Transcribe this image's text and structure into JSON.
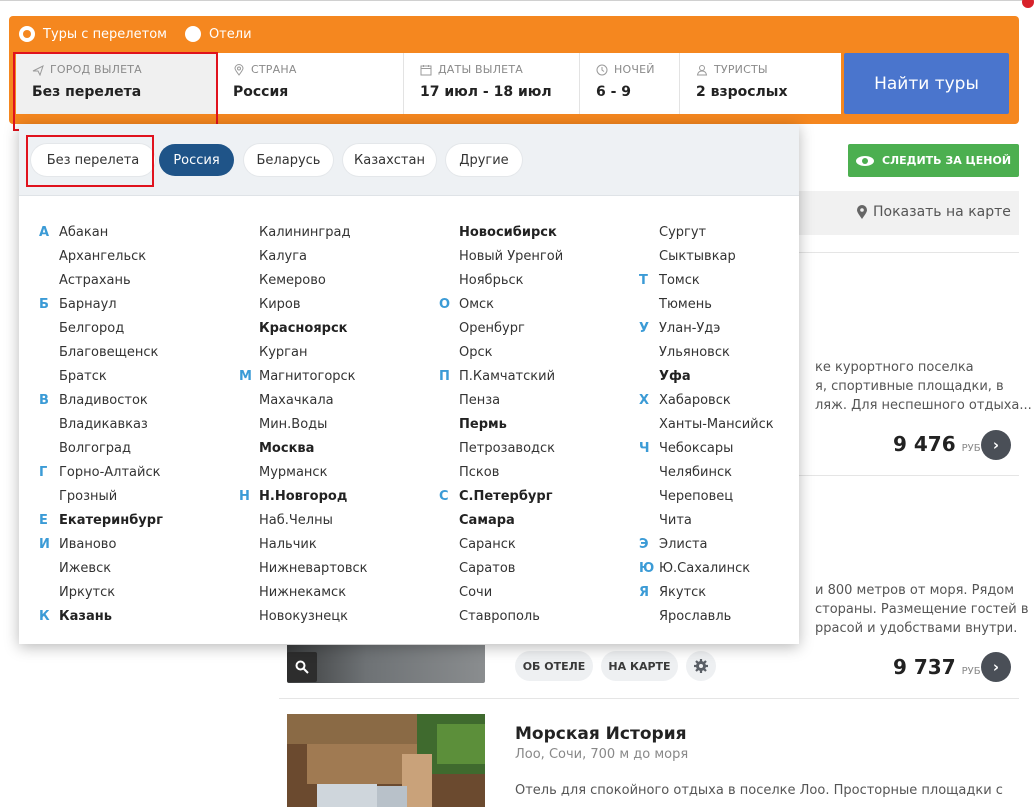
{
  "tour_type": {
    "options": [
      "Туры с перелетом",
      "Отели"
    ],
    "selected": "Туры с перелетом"
  },
  "fields": {
    "city": {
      "label": "ГОРОД ВЫЛЕТА",
      "value": "Без перелета",
      "icon": "plane-icon"
    },
    "country": {
      "label": "СТРАНА",
      "value": "Россия",
      "icon": "location-pin-icon"
    },
    "dates": {
      "label": "ДАТЫ ВЫЛЕТА",
      "value": "17 июл - 18 июл",
      "icon": "calendar-icon"
    },
    "nights": {
      "label": "НОЧЕЙ",
      "value": "6 - 9",
      "icon": "clock-icon"
    },
    "tourists": {
      "label": "ТУРИСТЫ",
      "value": "2 взрослых",
      "icon": "user-icon"
    }
  },
  "find_button": "Найти туры",
  "watch_price_button": "СЛЕДИТЬ ЗА ЦЕНОЙ",
  "show_on_map": "Показать на карте",
  "dropdown": {
    "tabs": [
      "Без перелета",
      "Россия",
      "Беларусь",
      "Казахстан",
      "Другие"
    ],
    "active_tab": "Россия",
    "columns": [
      [
        {
          "letter": "А",
          "name": "Абакан",
          "bold": false
        },
        {
          "letter": "",
          "name": "Архангельск",
          "bold": false
        },
        {
          "letter": "",
          "name": "Астрахань",
          "bold": false
        },
        {
          "letter": "Б",
          "name": "Барнаул",
          "bold": false
        },
        {
          "letter": "",
          "name": "Белгород",
          "bold": false
        },
        {
          "letter": "",
          "name": "Благовещенск",
          "bold": false
        },
        {
          "letter": "",
          "name": "Братск",
          "bold": false
        },
        {
          "letter": "В",
          "name": "Владивосток",
          "bold": false
        },
        {
          "letter": "",
          "name": "Владикавказ",
          "bold": false
        },
        {
          "letter": "",
          "name": "Волгоград",
          "bold": false
        },
        {
          "letter": "Г",
          "name": "Горно-Алтайск",
          "bold": false
        },
        {
          "letter": "",
          "name": "Грозный",
          "bold": false
        },
        {
          "letter": "Е",
          "name": "Екатеринбург",
          "bold": true
        },
        {
          "letter": "И",
          "name": "Иваново",
          "bold": false
        },
        {
          "letter": "",
          "name": "Ижевск",
          "bold": false
        },
        {
          "letter": "",
          "name": "Иркутск",
          "bold": false
        },
        {
          "letter": "К",
          "name": "Казань",
          "bold": true
        }
      ],
      [
        {
          "letter": "",
          "name": "Калининград",
          "bold": false
        },
        {
          "letter": "",
          "name": "Калуга",
          "bold": false
        },
        {
          "letter": "",
          "name": "Кемерово",
          "bold": false
        },
        {
          "letter": "",
          "name": "Киров",
          "bold": false
        },
        {
          "letter": "",
          "name": "Красноярск",
          "bold": true
        },
        {
          "letter": "",
          "name": "Курган",
          "bold": false
        },
        {
          "letter": "М",
          "name": "Магнитогорск",
          "bold": false
        },
        {
          "letter": "",
          "name": "Махачкала",
          "bold": false
        },
        {
          "letter": "",
          "name": "Мин.Воды",
          "bold": false
        },
        {
          "letter": "",
          "name": "Москва",
          "bold": true
        },
        {
          "letter": "",
          "name": "Мурманск",
          "bold": false
        },
        {
          "letter": "Н",
          "name": "Н.Новгород",
          "bold": true
        },
        {
          "letter": "",
          "name": "Наб.Челны",
          "bold": false
        },
        {
          "letter": "",
          "name": "Нальчик",
          "bold": false
        },
        {
          "letter": "",
          "name": "Нижневартовск",
          "bold": false
        },
        {
          "letter": "",
          "name": "Нижнекамск",
          "bold": false
        },
        {
          "letter": "",
          "name": "Новокузнецк",
          "bold": false
        }
      ],
      [
        {
          "letter": "",
          "name": "Новосибирск",
          "bold": true
        },
        {
          "letter": "",
          "name": "Новый Уренгой",
          "bold": false
        },
        {
          "letter": "",
          "name": "Ноябрьск",
          "bold": false
        },
        {
          "letter": "О",
          "name": "Омск",
          "bold": false
        },
        {
          "letter": "",
          "name": "Оренбург",
          "bold": false
        },
        {
          "letter": "",
          "name": "Орск",
          "bold": false
        },
        {
          "letter": "П",
          "name": "П.Камчатский",
          "bold": false
        },
        {
          "letter": "",
          "name": "Пенза",
          "bold": false
        },
        {
          "letter": "",
          "name": "Пермь",
          "bold": true
        },
        {
          "letter": "",
          "name": "Петрозаводск",
          "bold": false
        },
        {
          "letter": "",
          "name": "Псков",
          "bold": false
        },
        {
          "letter": "С",
          "name": "С.Петербург",
          "bold": true
        },
        {
          "letter": "",
          "name": "Самара",
          "bold": true
        },
        {
          "letter": "",
          "name": "Саранск",
          "bold": false
        },
        {
          "letter": "",
          "name": "Саратов",
          "bold": false
        },
        {
          "letter": "",
          "name": "Сочи",
          "bold": false
        },
        {
          "letter": "",
          "name": "Ставрополь",
          "bold": false
        }
      ],
      [
        {
          "letter": "",
          "name": "Сургут",
          "bold": false
        },
        {
          "letter": "",
          "name": "Сыктывкар",
          "bold": false
        },
        {
          "letter": "Т",
          "name": "Томск",
          "bold": false
        },
        {
          "letter": "",
          "name": "Тюмень",
          "bold": false
        },
        {
          "letter": "У",
          "name": "Улан-Удэ",
          "bold": false
        },
        {
          "letter": "",
          "name": "Ульяновск",
          "bold": false
        },
        {
          "letter": "",
          "name": "Уфа",
          "bold": true
        },
        {
          "letter": "Х",
          "name": "Хабаровск",
          "bold": false
        },
        {
          "letter": "",
          "name": "Ханты-Мансийск",
          "bold": false
        },
        {
          "letter": "Ч",
          "name": "Чебоксары",
          "bold": false
        },
        {
          "letter": "",
          "name": "Челябинск",
          "bold": false
        },
        {
          "letter": "",
          "name": "Череповец",
          "bold": false
        },
        {
          "letter": "",
          "name": "Чита",
          "bold": false
        },
        {
          "letter": "Э",
          "name": "Элиста",
          "bold": false
        },
        {
          "letter": "Ю",
          "name": "Ю.Сахалинск",
          "bold": false
        },
        {
          "letter": "Я",
          "name": "Якутск",
          "bold": false
        },
        {
          "letter": "",
          "name": "Ярославль",
          "bold": false
        }
      ]
    ]
  },
  "hotel_cards": [
    {
      "description_lines": [
        "ке курортного поселка",
        "я, спортивные площадки, в",
        "ляж. Для неспешного отдыха..."
      ],
      "price": "9 476",
      "currency": "РУБ"
    },
    {
      "description_lines": [
        "и 800 метров от моря. Рядом",
        "стораны. Размещение гостей в",
        "ррасой и удобствами внутри."
      ],
      "price": "9 737",
      "currency": "РУБ",
      "buttons": [
        "ОБ ОТЕЛЕ",
        "НА КАРТЕ"
      ]
    },
    {
      "title": "Морская История",
      "subtitle": "Лоо, Сочи, 700 м до моря",
      "description_lines": [
        "Отель для спокойного отдыха в поселке Лоо. Просторные площадки с"
      ]
    }
  ],
  "colors": {
    "panel_orange": "#f5871f",
    "find_blue": "#4a75cd",
    "tab_active": "#1f5488",
    "watch_green": "#4caf50",
    "letter_blue": "#3b9bd6",
    "highlight_red": "#e0121d"
  }
}
